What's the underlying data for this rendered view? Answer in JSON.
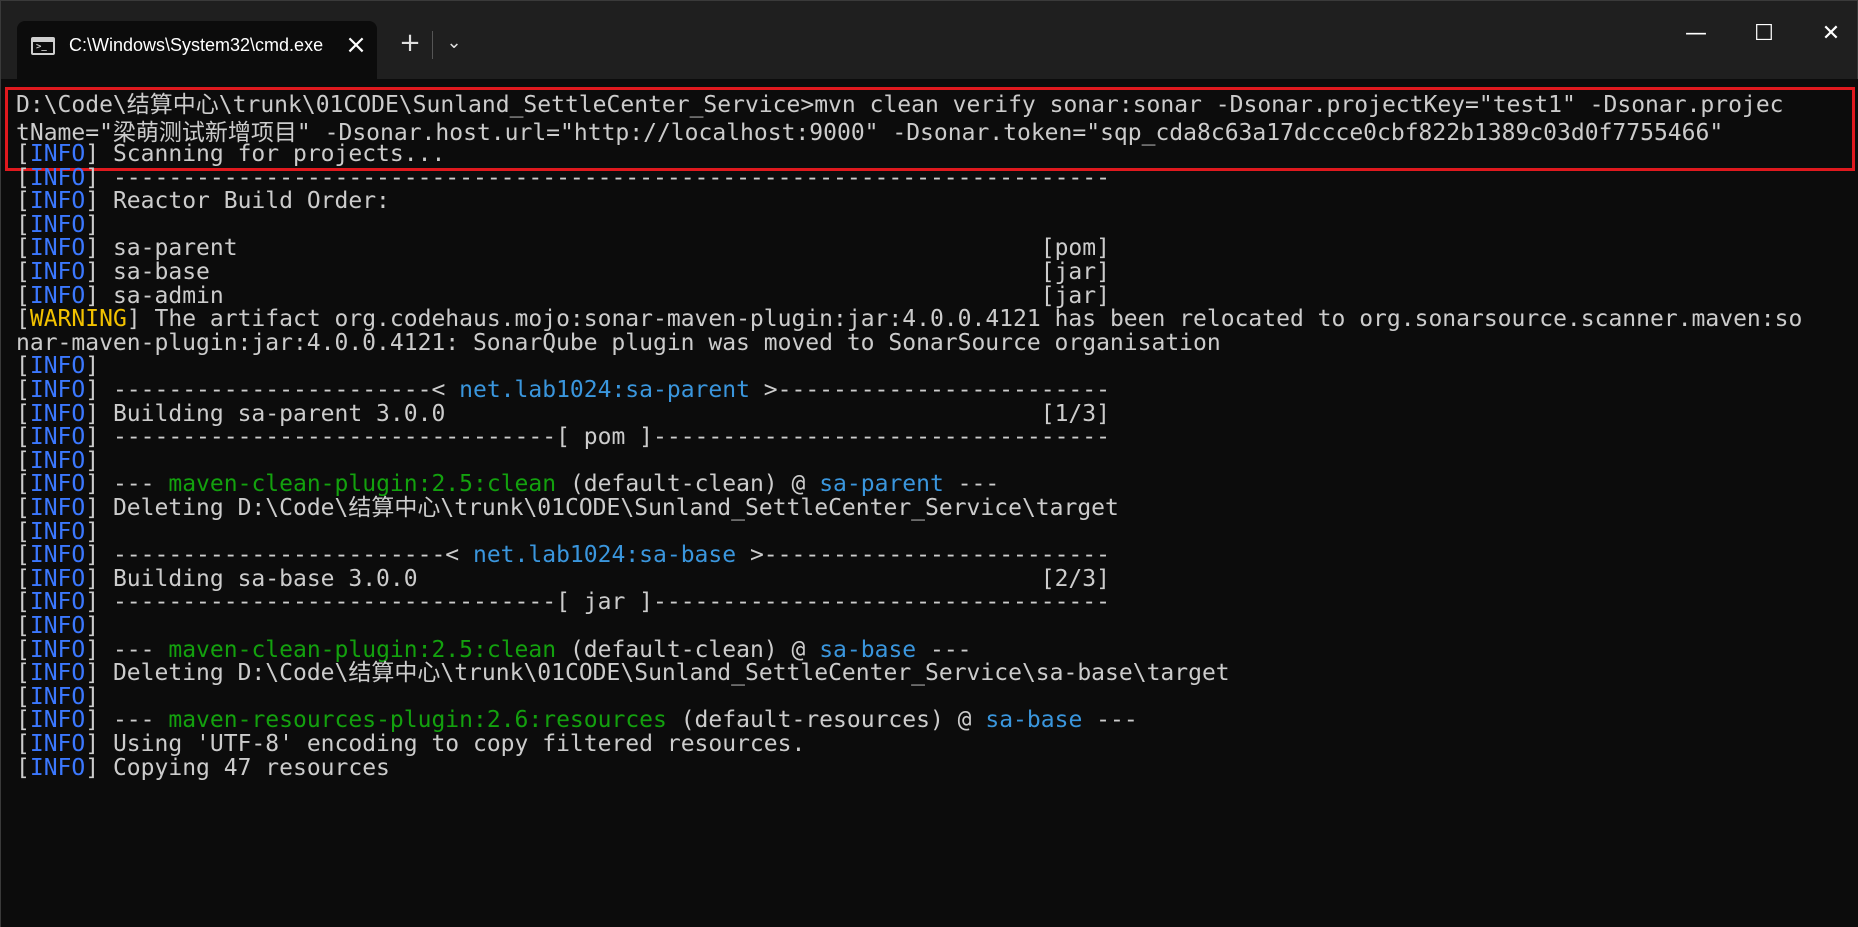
{
  "tab": {
    "title": "C:\\Windows\\System32\\cmd.exe",
    "icon": "terminal-icon",
    "icon_glyph": ">_"
  },
  "toolbar": {
    "new_tab_glyph": "+",
    "dropdown_glyph": "⌄",
    "close_tab_glyph": "×"
  },
  "window_controls": {
    "minimize_glyph": "—",
    "maximize_glyph": "☐",
    "close_glyph": "✕"
  },
  "colors": {
    "info": "#3b78ff",
    "warning": "#f2c200",
    "artifact": "#3a96dd",
    "plugin": "#13a10e",
    "highlight_box": "#e0191e"
  },
  "command": {
    "line1": "D:\\Code\\结算中心\\trunk\\01CODE\\Sunland_SettleCenter_Service>mvn clean verify sonar:sonar -Dsonar.projectKey=\"test1\" -Dsonar.projec",
    "line2": "tName=\"梁萌测试新增项目\" -Dsonar.host.url=\"http://localhost:9000\" -Dsonar.token=\"sqp_cda8c63a17dccce0cbf822b1389c03d0f7755466\""
  },
  "output": [
    {
      "level": "INFO",
      "segments": [
        {
          "t": " Scanning for projects..."
        }
      ]
    },
    {
      "level": "INFO",
      "segments": [
        {
          "t": " ------------------------------------------------------------------------"
        }
      ]
    },
    {
      "level": "INFO",
      "segments": [
        {
          "t": " Reactor Build Order:"
        }
      ]
    },
    {
      "level": "INFO",
      "segments": [
        {
          "t": ""
        }
      ]
    },
    {
      "level": "INFO",
      "segments": [
        {
          "t": " sa-parent                                                          [pom]"
        }
      ]
    },
    {
      "level": "INFO",
      "segments": [
        {
          "t": " sa-base                                                            [jar]"
        }
      ]
    },
    {
      "level": "INFO",
      "segments": [
        {
          "t": " sa-admin                                                           [jar]"
        }
      ]
    },
    {
      "level": "WARNING",
      "segments": [
        {
          "t": " The artifact org.codehaus.mojo:sonar-maven-plugin:jar:4.0.0.4121 has been relocated to org.sonarsource.scanner.maven:so"
        }
      ]
    },
    {
      "level": "",
      "segments": [
        {
          "t": "nar-maven-plugin:jar:4.0.0.4121: SonarQube plugin was moved to SonarSource organisation"
        }
      ]
    },
    {
      "level": "INFO",
      "segments": [
        {
          "t": ""
        }
      ]
    },
    {
      "level": "INFO",
      "segments": [
        {
          "t": " -----------------------< "
        },
        {
          "t": "net.lab1024:sa-parent",
          "c": "blue"
        },
        {
          "t": " >------------------------"
        }
      ]
    },
    {
      "level": "INFO",
      "segments": [
        {
          "t": " Building sa-parent 3.0.0                                           [1/3]"
        }
      ]
    },
    {
      "level": "INFO",
      "segments": [
        {
          "t": " --------------------------------[ pom ]---------------------------------"
        }
      ]
    },
    {
      "level": "INFO",
      "segments": [
        {
          "t": ""
        }
      ]
    },
    {
      "level": "INFO",
      "segments": [
        {
          "t": " --- "
        },
        {
          "t": "maven-clean-plugin:2.5:clean",
          "c": "green"
        },
        {
          "t": " (default-clean) @ "
        },
        {
          "t": "sa-parent",
          "c": "blue"
        },
        {
          "t": " ---"
        }
      ]
    },
    {
      "level": "INFO",
      "segments": [
        {
          "t": " Deleting D:\\Code\\结算中心\\trunk\\01CODE\\Sunland_SettleCenter_Service\\target"
        }
      ]
    },
    {
      "level": "INFO",
      "segments": [
        {
          "t": ""
        }
      ]
    },
    {
      "level": "INFO",
      "segments": [
        {
          "t": " ------------------------< "
        },
        {
          "t": "net.lab1024:sa-base",
          "c": "blue"
        },
        {
          "t": " >-------------------------"
        }
      ]
    },
    {
      "level": "INFO",
      "segments": [
        {
          "t": " Building sa-base 3.0.0                                             [2/3]"
        }
      ]
    },
    {
      "level": "INFO",
      "segments": [
        {
          "t": " --------------------------------[ jar ]---------------------------------"
        }
      ]
    },
    {
      "level": "INFO",
      "segments": [
        {
          "t": ""
        }
      ]
    },
    {
      "level": "INFO",
      "segments": [
        {
          "t": " --- "
        },
        {
          "t": "maven-clean-plugin:2.5:clean",
          "c": "green"
        },
        {
          "t": " (default-clean) @ "
        },
        {
          "t": "sa-base",
          "c": "blue"
        },
        {
          "t": " ---"
        }
      ]
    },
    {
      "level": "INFO",
      "segments": [
        {
          "t": " Deleting D:\\Code\\结算中心\\trunk\\01CODE\\Sunland_SettleCenter_Service\\sa-base\\target"
        }
      ]
    },
    {
      "level": "INFO",
      "segments": [
        {
          "t": ""
        }
      ]
    },
    {
      "level": "INFO",
      "segments": [
        {
          "t": " --- "
        },
        {
          "t": "maven-resources-plugin:2.6:resources",
          "c": "green"
        },
        {
          "t": " (default-resources) @ "
        },
        {
          "t": "sa-base",
          "c": "blue"
        },
        {
          "t": " ---"
        }
      ]
    },
    {
      "level": "INFO",
      "segments": [
        {
          "t": " Using 'UTF-8' encoding to copy filtered resources."
        }
      ]
    },
    {
      "level": "INFO",
      "segments": [
        {
          "t": " Copying 47 resources"
        }
      ]
    }
  ]
}
